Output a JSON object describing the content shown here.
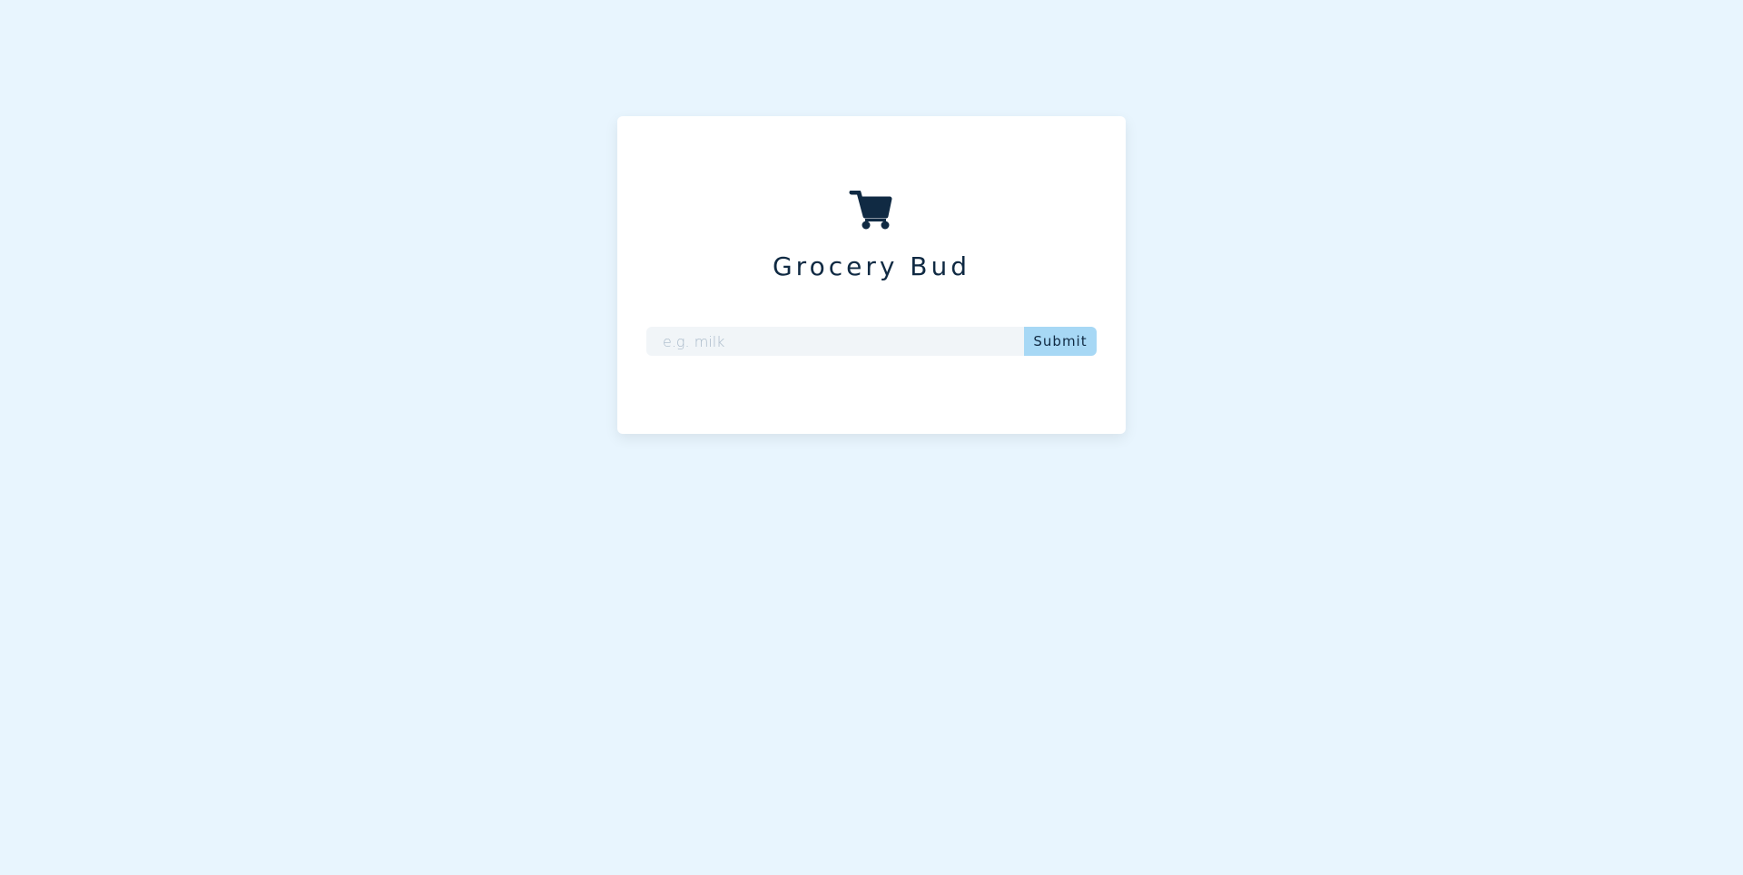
{
  "app": {
    "title": "Grocery Bud",
    "icon": "shopping-cart-icon"
  },
  "form": {
    "input_value": "",
    "input_placeholder": "e.g. milk",
    "submit_label": "Submit"
  },
  "colors": {
    "page_background": "#e8f5fe",
    "card_background": "#ffffff",
    "brand_dark": "#102a43",
    "input_background": "#f1f5f8",
    "submit_background": "#a7d8f5",
    "placeholder_text": "#a8b9c9"
  }
}
